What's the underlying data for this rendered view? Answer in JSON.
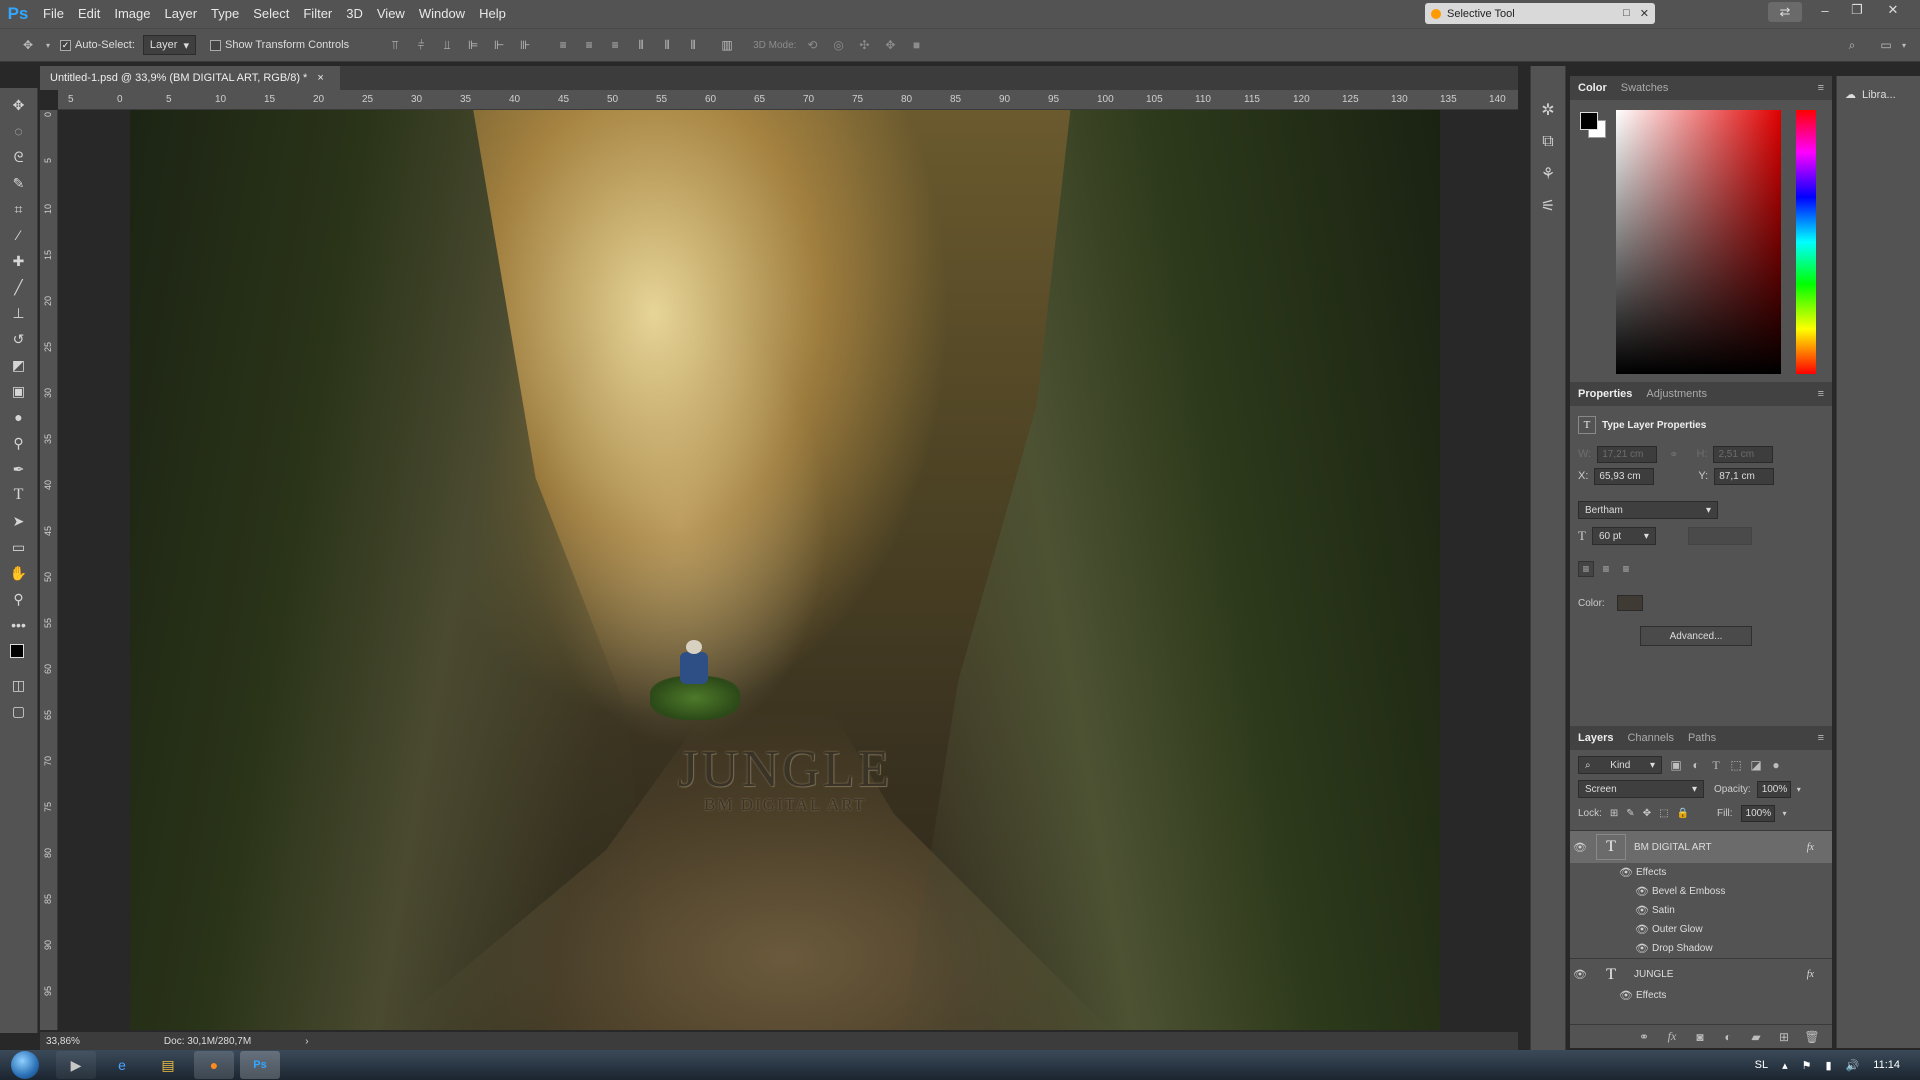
{
  "menubar": {
    "logo": "Ps",
    "items": [
      "File",
      "Edit",
      "Image",
      "Layer",
      "Type",
      "Select",
      "Filter",
      "3D",
      "View",
      "Window",
      "Help"
    ],
    "extension_tab": "Selective Tool"
  },
  "options": {
    "auto_select_label": "Auto-Select:",
    "auto_select_target": "Layer",
    "show_transform_label": "Show Transform Controls",
    "mode_3d_label": "3D Mode:"
  },
  "document": {
    "tab_title": "Untitled-1.psd @ 33,9% (BM DIGITAL ART, RGB/8) *",
    "close_glyph": "×",
    "ruler_top": [
      "5",
      "0",
      "5",
      "10",
      "15",
      "20",
      "25",
      "30",
      "35",
      "40",
      "45",
      "50",
      "55",
      "60",
      "65",
      "70",
      "75",
      "80",
      "85",
      "90",
      "95",
      "100",
      "105",
      "110",
      "115",
      "120",
      "125",
      "130",
      "135",
      "140"
    ],
    "ruler_left": [
      "0",
      "5",
      "10",
      "15",
      "20",
      "25",
      "30",
      "35",
      "40",
      "45",
      "50",
      "55",
      "60",
      "65",
      "70",
      "75",
      "80",
      "85",
      "90",
      "95"
    ],
    "artwork_title": "JUNGLE",
    "artwork_subtitle": "BM DIGITAL ART"
  },
  "status": {
    "zoom": "33,86%",
    "doc": "Doc: 30,1M/280,7M",
    "arrow": "›"
  },
  "panels": {
    "color_tabs": [
      "Color",
      "Swatches"
    ],
    "properties_tabs": [
      "Properties",
      "Adjustments"
    ],
    "properties": {
      "heading": "Type Layer Properties",
      "w_label": "W:",
      "w_value": "17,21 cm",
      "h_label": "H:",
      "h_value": "2,51 cm",
      "x_label": "X:",
      "x_value": "65,93 cm",
      "y_label": "Y:",
      "y_value": "87,1 cm",
      "font": "Bertham",
      "size": "60 pt",
      "color_label": "Color:",
      "color_value": "#3f3a33",
      "advanced": "Advanced..."
    },
    "layers_tabs": [
      "Layers",
      "Channels",
      "Paths"
    ],
    "layers": {
      "kind": "Kind",
      "blend_mode": "Screen",
      "opacity_label": "Opacity:",
      "opacity": "100%",
      "lock_label": "Lock:",
      "fill_label": "Fill:",
      "fill": "100%",
      "rows": [
        {
          "name": "BM DIGITAL ART",
          "type": "T",
          "fx": "fx"
        },
        {
          "name": "Effects"
        },
        {
          "name": "Bevel & Emboss"
        },
        {
          "name": "Satin"
        },
        {
          "name": "Outer Glow"
        },
        {
          "name": "Drop Shadow"
        },
        {
          "name": "JUNGLE",
          "type": "T",
          "fx": "fx"
        },
        {
          "name": "Effects"
        }
      ]
    },
    "libraries": "Libra..."
  },
  "taskbar": {
    "lang": "SL",
    "time": "11:14"
  },
  "colors": {
    "accent": "#31a8ff",
    "panel_bg": "#535353",
    "canvas_bg": "#282828",
    "foreground": "#000000",
    "background": "#ffffff"
  }
}
